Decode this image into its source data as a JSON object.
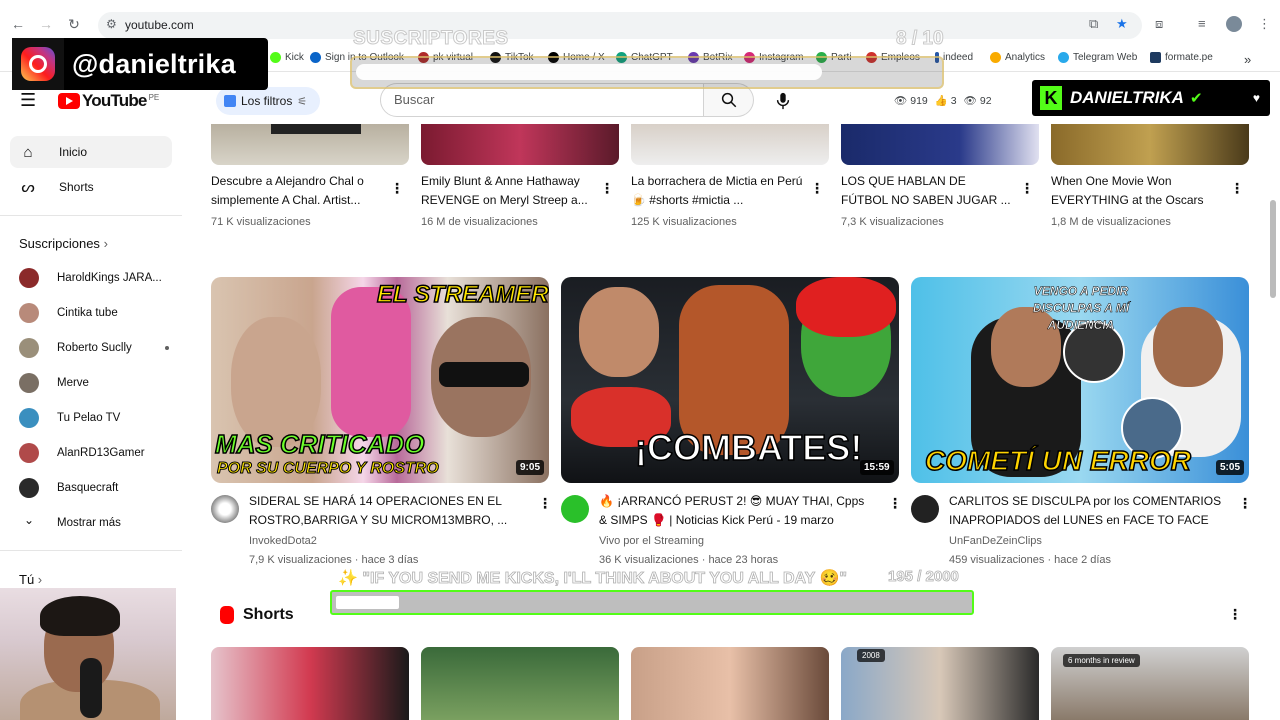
{
  "browser": {
    "url": "youtube.com",
    "bookmarks": [
      "Kick",
      "Sign in to Outlook",
      "pk virtual",
      "TikTok",
      "Home / X",
      "ChatGPT",
      "BotRix",
      "Instagram",
      "Parti",
      "Empleos",
      "indeed",
      "Analytics",
      "Telegram Web",
      "formate.pe"
    ]
  },
  "overlays": {
    "instagram_handle": "@danieltrika",
    "sub_goal_label": "SUSCRIPTORES",
    "sub_goal_count": "8 / 10",
    "sub_goal_progress": 0.8,
    "kick_name": "DANIELTRIKA",
    "kick_goal_label": "✨ \"IF YOU SEND ME KICKS, I'LL THINK ABOUT YOU ALL DAY 🥴\"",
    "kick_goal_count": "195 / 2000",
    "kick_goal_progress": 0.1
  },
  "header": {
    "logo_text": "YouTube",
    "country": "PE",
    "filters_label": "Los filtros",
    "search_placeholder": "Buscar",
    "stats": {
      "views": "919",
      "likes": "3",
      "watching": "92"
    }
  },
  "sidebar": {
    "items": [
      {
        "label": "Inicio"
      },
      {
        "label": "Shorts"
      }
    ],
    "subscriptions_header": "Suscripciones",
    "subscriptions": [
      {
        "name": "HaroldKings JARA...",
        "color": "#8b2a2a"
      },
      {
        "name": "Cintika tube",
        "color": "#b88a7a"
      },
      {
        "name": "Roberto Suclly",
        "color": "#9a8f7a"
      },
      {
        "name": "Merve",
        "color": "#7a6f64"
      },
      {
        "name": "Tu Pelao TV",
        "color": "#3a8fbf"
      },
      {
        "name": "AlanRD13Gamer",
        "color": "#b04a4a"
      },
      {
        "name": "Basquecraft",
        "color": "#2a2a2a"
      }
    ],
    "show_more": "Mostrar más",
    "you_header": "Tú"
  },
  "videos_top": [
    {
      "title": "Descubre a Alejandro Chal o simplemente A Chal. Artist...",
      "views": "71 K visualizaciones"
    },
    {
      "title": "Emily Blunt & Anne Hathaway REVENGE on Meryl Streep a...",
      "views": "16 M de visualizaciones"
    },
    {
      "title": "La borrachera de Mictia en Perú 🍺 #shorts #mictia ...",
      "views": "125 K visualizaciones"
    },
    {
      "title": "LOS QUE HABLAN DE FÚTBOL NO SABEN JUGAR ...",
      "views": "7,3 K visualizaciones"
    },
    {
      "title": "When One Movie Won EVERYTHING at the Oscars",
      "views": "1,8 M de visualizaciones"
    }
  ],
  "videos_main": [
    {
      "title": "SIDERAL SE HARÁ 14 OPERACIONES EN EL ROSTRO,BARRIGA Y SU MICROM13MBRO, ...",
      "channel": "InvokedDota2",
      "meta": "7,9 K visualizaciones · hace 3 días",
      "duration": "9:05",
      "overlay_top": "EL STREAMER",
      "overlay_main": "MAS CRITICADO",
      "overlay_sub": "POR SU CUERPO Y ROSTRO"
    },
    {
      "title": "🔥 ¡ARRANCÓ PERUST 2! 😎 MUAY THAI, Cpps & SIMPS 🥊 | Noticias Kick Perú - 19 marzo",
      "channel": "Vivo por el Streaming",
      "meta": "36 K visualizaciones · hace 23 horas",
      "duration": "15:59",
      "overlay_main": "¡COMBATES!"
    },
    {
      "title": "CARLITOS SE DISCULPA por los COMENTARIOS INAPROPIADOS del LUNES en FACE TO FACE",
      "channel": "UnFanDeZeinClips",
      "meta": "459 visualizaciones · hace 2 días",
      "duration": "5:05",
      "overlay_top": "VENGO A PEDIR DISCULPAS A MÍ AUDIENCIA",
      "overlay_main": "COMETÍ UN ERROR"
    }
  ],
  "shorts": {
    "title": "Shorts",
    "tags": [
      "2008",
      "6 months in review"
    ]
  }
}
